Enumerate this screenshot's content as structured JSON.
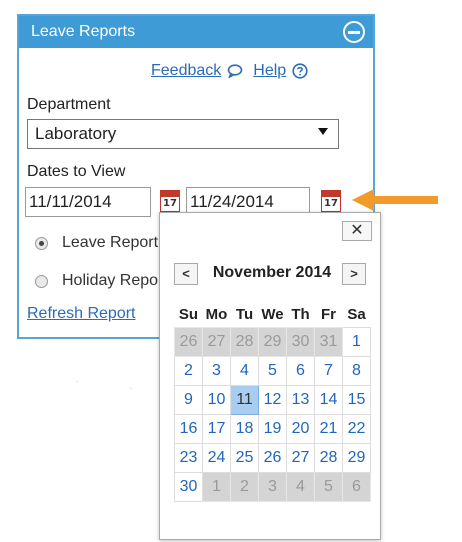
{
  "panel": {
    "title": "Leave Reports",
    "feedback_label": "Feedback",
    "help_label": "Help",
    "department_label": "Department",
    "department_value": "Laboratory",
    "dates_label": "Dates to View",
    "start_date": "11/11/2014",
    "end_date": "11/24/2014",
    "calendar_icon_number": "17",
    "radio_leave": "Leave Report",
    "radio_holiday": "Holiday Report",
    "refresh_label": "Refresh Report"
  },
  "datepicker": {
    "close_label": "✕",
    "prev_label": "<",
    "next_label": ">",
    "month_label": "November 2014",
    "weekdays": [
      "Su",
      "Mo",
      "Tu",
      "We",
      "Th",
      "Fr",
      "Sa"
    ],
    "weeks": [
      [
        "26",
        "27",
        "28",
        "29",
        "30",
        "31",
        "1"
      ],
      [
        "2",
        "3",
        "4",
        "5",
        "6",
        "7",
        "8"
      ],
      [
        "9",
        "10",
        "11",
        "12",
        "13",
        "14",
        "15"
      ],
      [
        "16",
        "17",
        "18",
        "19",
        "20",
        "21",
        "22"
      ],
      [
        "23",
        "24",
        "25",
        "26",
        "27",
        "28",
        "29"
      ],
      [
        "30",
        "1",
        "2",
        "3",
        "4",
        "5",
        "6"
      ]
    ],
    "selected_day": "11"
  },
  "colors": {
    "header_bg": "#3e9bd5",
    "link": "#2b6cb8",
    "arrow": "#f39a2c",
    "selected_day_bg": "#a9cdf0"
  }
}
